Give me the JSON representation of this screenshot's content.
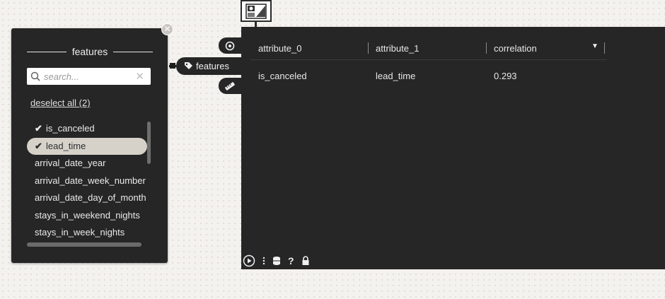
{
  "panel": {
    "title": "features",
    "search_placeholder": "search...",
    "deselect_label": "deselect all (2)",
    "items": [
      {
        "label": "is_canceled",
        "checked": true
      },
      {
        "label": "lead_time",
        "checked": true
      },
      {
        "label": "arrival_date_year",
        "checked": false
      },
      {
        "label": "arrival_date_week_number",
        "checked": false
      },
      {
        "label": "arrival_date_day_of_month",
        "checked": false
      },
      {
        "label": "stays_in_weekend_nights",
        "checked": false
      },
      {
        "label": "stays_in_week_nights",
        "checked": false
      }
    ]
  },
  "node": {
    "features_tab_label": "features"
  },
  "table": {
    "columns": [
      "attribute_0",
      "attribute_1",
      "correlation"
    ],
    "rows": [
      [
        "is_canceled",
        "lead_time",
        "0.293"
      ]
    ]
  },
  "colors": {
    "panel_bg": "#262626",
    "canvas_bg": "#f4f2ee",
    "highlight": "#d6d2ca"
  }
}
